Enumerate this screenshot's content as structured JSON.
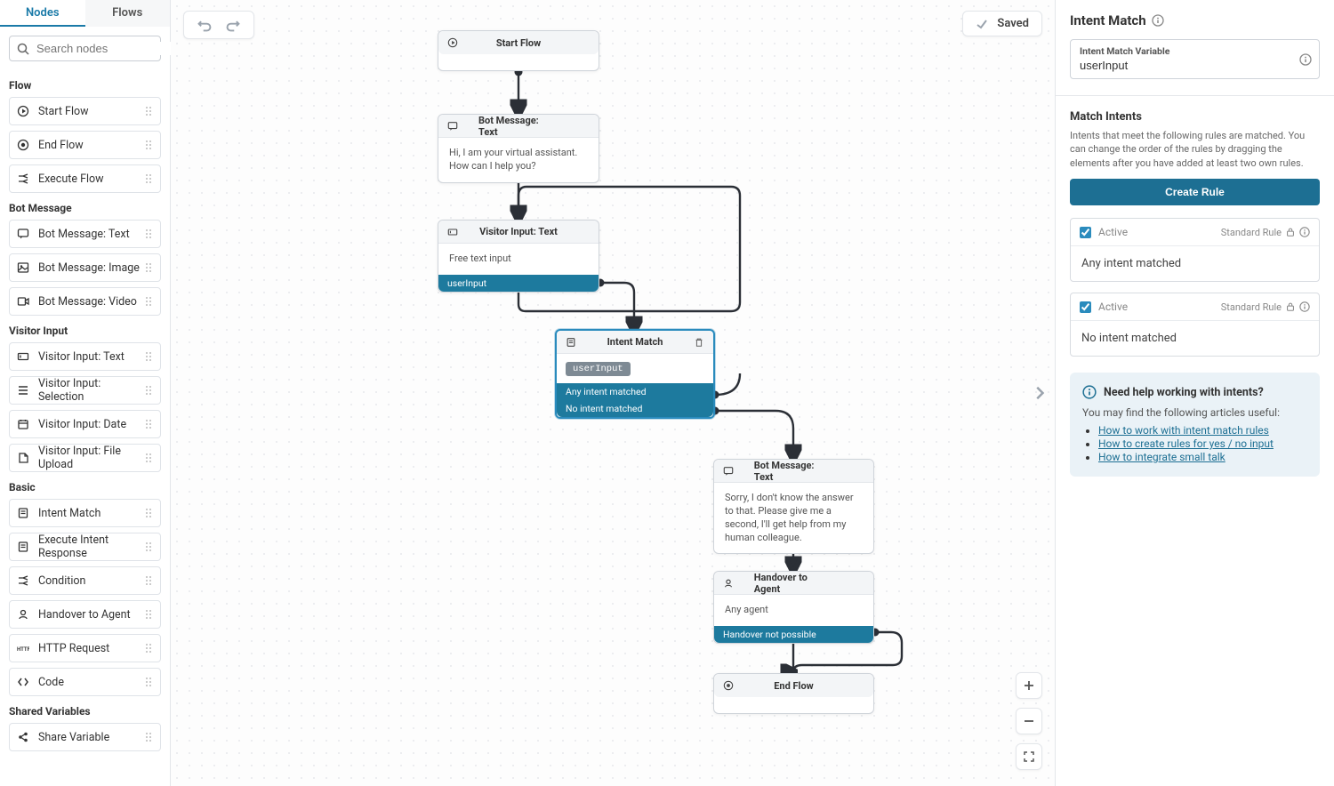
{
  "tabs": {
    "nodes": "Nodes",
    "flows": "Flows"
  },
  "search": {
    "placeholder": "Search nodes"
  },
  "palette": {
    "groups": [
      {
        "title": "Flow",
        "items": [
          {
            "icon": "play-circle",
            "label": "Start Flow"
          },
          {
            "icon": "stop-circle",
            "label": "End Flow"
          },
          {
            "icon": "branch",
            "label": "Execute Flow"
          }
        ]
      },
      {
        "title": "Bot Message",
        "items": [
          {
            "icon": "chat",
            "label": "Bot Message: Text"
          },
          {
            "icon": "image",
            "label": "Bot Message: Image"
          },
          {
            "icon": "video",
            "label": "Bot Message: Video"
          }
        ]
      },
      {
        "title": "Visitor Input",
        "items": [
          {
            "icon": "input",
            "label": "Visitor Input: Text"
          },
          {
            "icon": "list",
            "label": "Visitor Input: Selection"
          },
          {
            "icon": "calendar",
            "label": "Visitor Input: Date"
          },
          {
            "icon": "file",
            "label": "Visitor Input: File Upload"
          }
        ]
      },
      {
        "title": "Basic",
        "items": [
          {
            "icon": "doc",
            "label": "Intent Match"
          },
          {
            "icon": "doc",
            "label": "Execute Intent Response"
          },
          {
            "icon": "branch",
            "label": "Condition"
          },
          {
            "icon": "agent",
            "label": "Handover to Agent"
          },
          {
            "icon": "http",
            "label": "HTTP Request"
          },
          {
            "icon": "code",
            "label": "Code"
          }
        ]
      },
      {
        "title": "Shared Variables",
        "items": [
          {
            "icon": "share",
            "label": "Share Variable"
          }
        ]
      }
    ]
  },
  "canvas": {
    "saved_label": "Saved",
    "nodes": {
      "start": {
        "title": "Start Flow"
      },
      "bot1": {
        "title": "Bot Message: Text",
        "body": "Hi, I am your virtual assistant. How can I help you?"
      },
      "vin": {
        "title": "Visitor Input: Text",
        "body": "Free text input",
        "out": "userInput"
      },
      "intent": {
        "title": "Intent Match",
        "chip": "userInput",
        "out1": "Any intent matched",
        "out2": "No intent matched"
      },
      "bot2": {
        "title": "Bot Message: Text",
        "body": "Sorry, I don't know the answer to that. Please give me a second, I'll get help from my human colleague."
      },
      "hand": {
        "title": "Handover to Agent",
        "body": "Any agent",
        "out": "Handover not possible"
      },
      "end": {
        "title": "End Flow"
      }
    }
  },
  "inspector": {
    "title": "Intent Match",
    "var_label": "Intent Match Variable",
    "var_value": "userInput",
    "match_title": "Match Intents",
    "match_help": "Intents that meet the following rules are matched. You can change the order of the rules by dragging the elements after you have added at least two own rules.",
    "create_rule": "Create Rule",
    "active": "Active",
    "standard_rule": "Standard Rule",
    "rule1": "Any intent matched",
    "rule2": "No intent matched",
    "tip_title": "Need help working with intents?",
    "tip_intro": "You may find the following articles useful:",
    "tip_links": {
      "a": "How to work with intent match rules",
      "b": "How to create rules for yes / no input",
      "c": "How to integrate small talk"
    }
  }
}
